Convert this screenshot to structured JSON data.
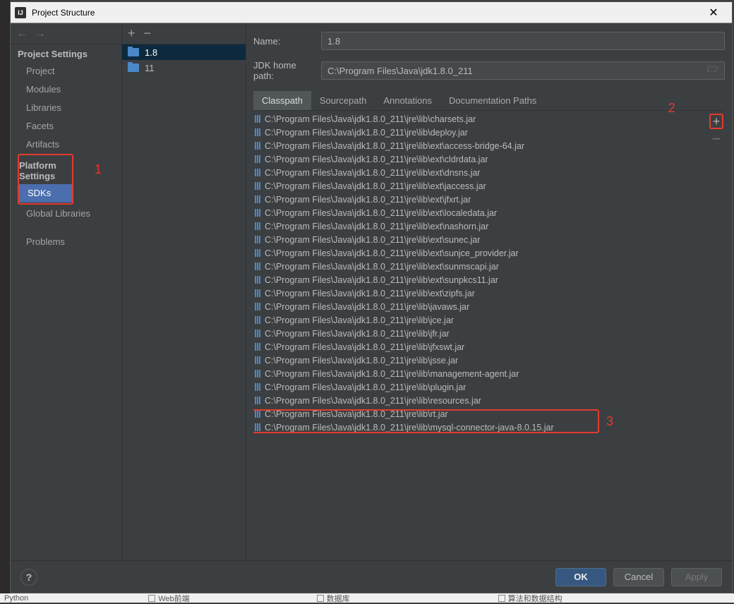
{
  "window": {
    "title": "Project Structure"
  },
  "leftnav": {
    "project_settings_label": "Project Settings",
    "project_items": [
      "Project",
      "Modules",
      "Libraries",
      "Facets",
      "Artifacts"
    ],
    "platform_settings_label": "Platform Settings",
    "platform_items": [
      "SDKs",
      "Global Libraries"
    ],
    "problems_label": "Problems"
  },
  "sdks": [
    {
      "name": "1.8",
      "selected": true
    },
    {
      "name": "11",
      "selected": false
    }
  ],
  "form": {
    "name_label": "Name:",
    "name_value": "1.8",
    "jdk_home_label": "JDK home path:",
    "jdk_home_value": "C:\\Program Files\\Java\\jdk1.8.0_211"
  },
  "tabs": [
    "Classpath",
    "Sourcepath",
    "Annotations",
    "Documentation Paths"
  ],
  "active_tab": "Classpath",
  "classpath": [
    "C:\\Program Files\\Java\\jdk1.8.0_211\\jre\\lib\\charsets.jar",
    "C:\\Program Files\\Java\\jdk1.8.0_211\\jre\\lib\\deploy.jar",
    "C:\\Program Files\\Java\\jdk1.8.0_211\\jre\\lib\\ext\\access-bridge-64.jar",
    "C:\\Program Files\\Java\\jdk1.8.0_211\\jre\\lib\\ext\\cldrdata.jar",
    "C:\\Program Files\\Java\\jdk1.8.0_211\\jre\\lib\\ext\\dnsns.jar",
    "C:\\Program Files\\Java\\jdk1.8.0_211\\jre\\lib\\ext\\jaccess.jar",
    "C:\\Program Files\\Java\\jdk1.8.0_211\\jre\\lib\\ext\\jfxrt.jar",
    "C:\\Program Files\\Java\\jdk1.8.0_211\\jre\\lib\\ext\\localedata.jar",
    "C:\\Program Files\\Java\\jdk1.8.0_211\\jre\\lib\\ext\\nashorn.jar",
    "C:\\Program Files\\Java\\jdk1.8.0_211\\jre\\lib\\ext\\sunec.jar",
    "C:\\Program Files\\Java\\jdk1.8.0_211\\jre\\lib\\ext\\sunjce_provider.jar",
    "C:\\Program Files\\Java\\jdk1.8.0_211\\jre\\lib\\ext\\sunmscapi.jar",
    "C:\\Program Files\\Java\\jdk1.8.0_211\\jre\\lib\\ext\\sunpkcs11.jar",
    "C:\\Program Files\\Java\\jdk1.8.0_211\\jre\\lib\\ext\\zipfs.jar",
    "C:\\Program Files\\Java\\jdk1.8.0_211\\jre\\lib\\javaws.jar",
    "C:\\Program Files\\Java\\jdk1.8.0_211\\jre\\lib\\jce.jar",
    "C:\\Program Files\\Java\\jdk1.8.0_211\\jre\\lib\\jfr.jar",
    "C:\\Program Files\\Java\\jdk1.8.0_211\\jre\\lib\\jfxswt.jar",
    "C:\\Program Files\\Java\\jdk1.8.0_211\\jre\\lib\\jsse.jar",
    "C:\\Program Files\\Java\\jdk1.8.0_211\\jre\\lib\\management-agent.jar",
    "C:\\Program Files\\Java\\jdk1.8.0_211\\jre\\lib\\plugin.jar",
    "C:\\Program Files\\Java\\jdk1.8.0_211\\jre\\lib\\resources.jar",
    "C:\\Program Files\\Java\\jdk1.8.0_211\\jre\\lib\\rt.jar",
    "C:\\Program Files\\Java\\jdk1.8.0_211\\jre\\lib\\mysql-connector-java-8.0.15.jar"
  ],
  "buttons": {
    "ok": "OK",
    "cancel": "Cancel",
    "apply": "Apply"
  },
  "annotations": {
    "n1": "1",
    "n2": "2",
    "n3": "3"
  },
  "background": {
    "left": "Python",
    "opt1": "Web前端",
    "opt2": "数据库",
    "opt3": "算法和数据结构"
  }
}
